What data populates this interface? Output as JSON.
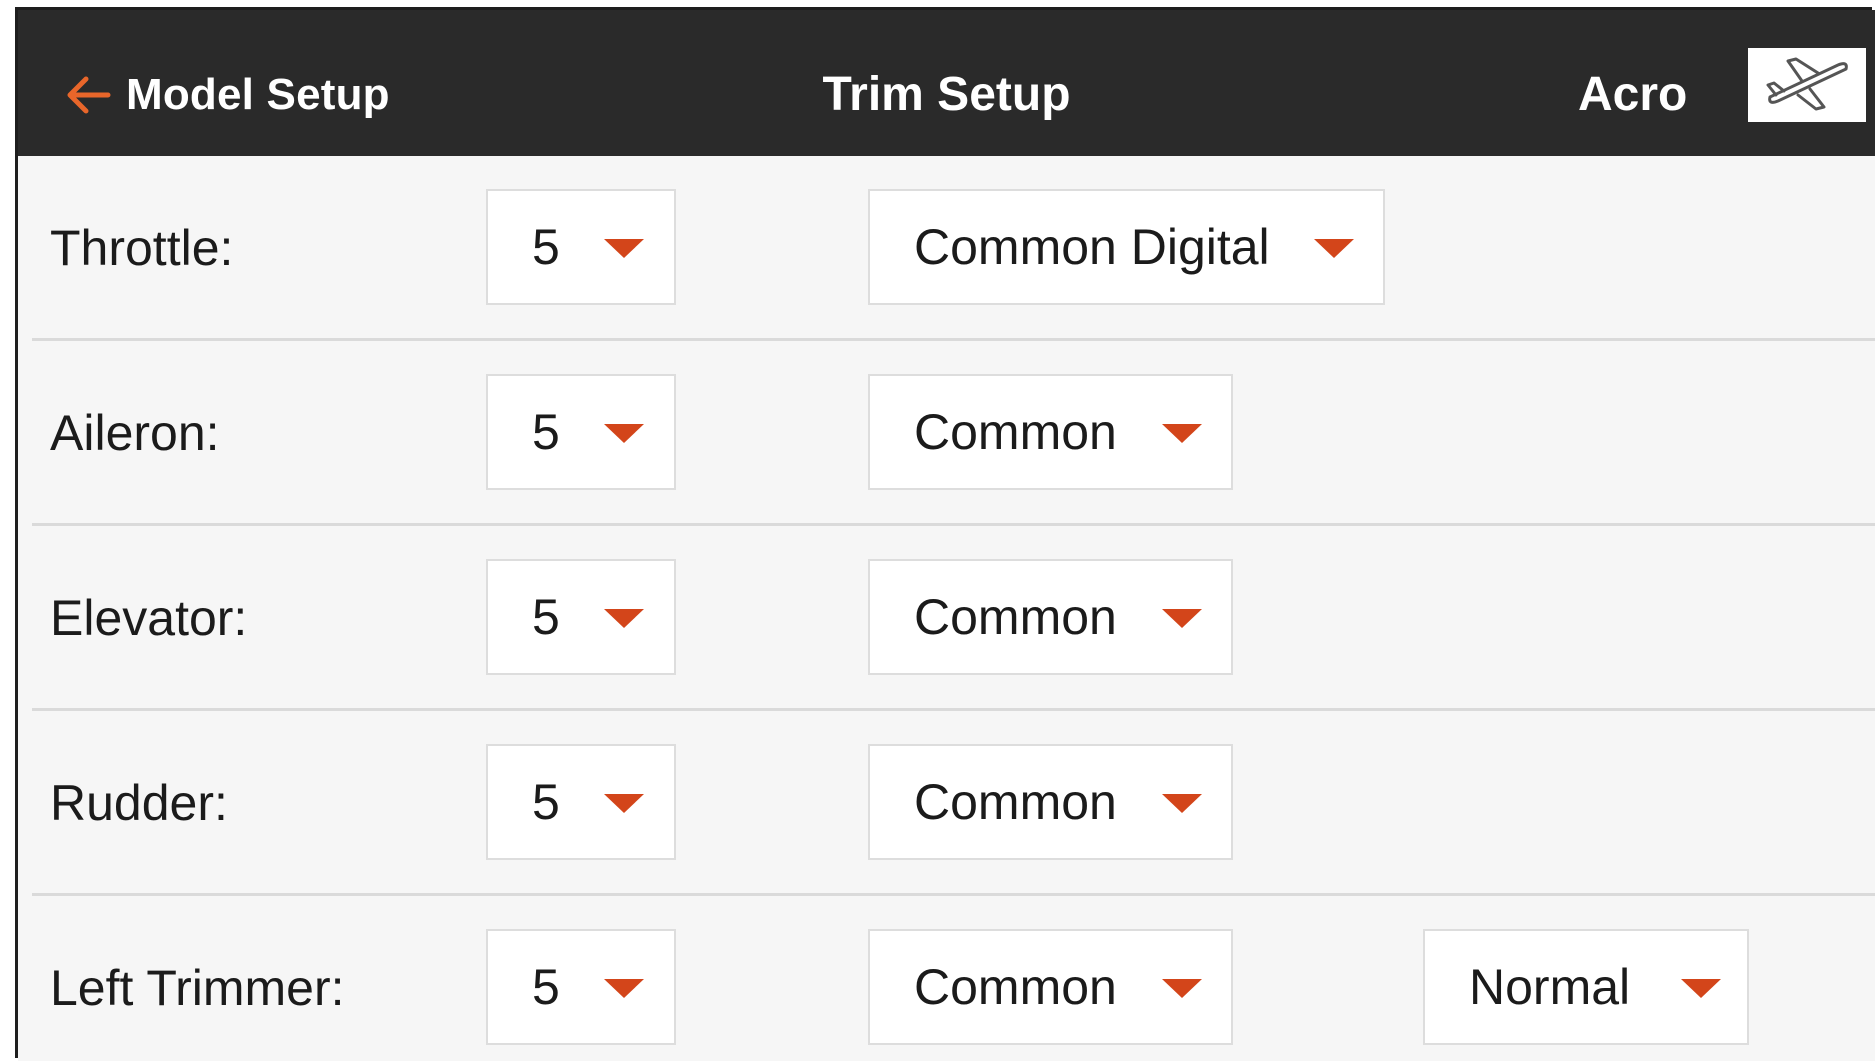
{
  "header": {
    "back_label": "Model Setup",
    "title": "Trim Setup",
    "model_type": "Acro",
    "model_icon": "airplane-icon"
  },
  "colors": {
    "header_bg": "#2a2a2a",
    "accent": "#d3451a",
    "back_arrow": "#e8662a",
    "body_bg": "#f6f6f6"
  },
  "rows": [
    {
      "label": "Throttle:",
      "steps": "5",
      "mode": "Common Digital"
    },
    {
      "label": "Aileron:",
      "steps": "5",
      "mode": "Common"
    },
    {
      "label": "Elevator:",
      "steps": "5",
      "mode": "Common"
    },
    {
      "label": "Rudder:",
      "steps": "5",
      "mode": "Common"
    },
    {
      "label": "Left Trimmer:",
      "steps": "5",
      "mode": "Common",
      "direction": "Normal"
    }
  ]
}
